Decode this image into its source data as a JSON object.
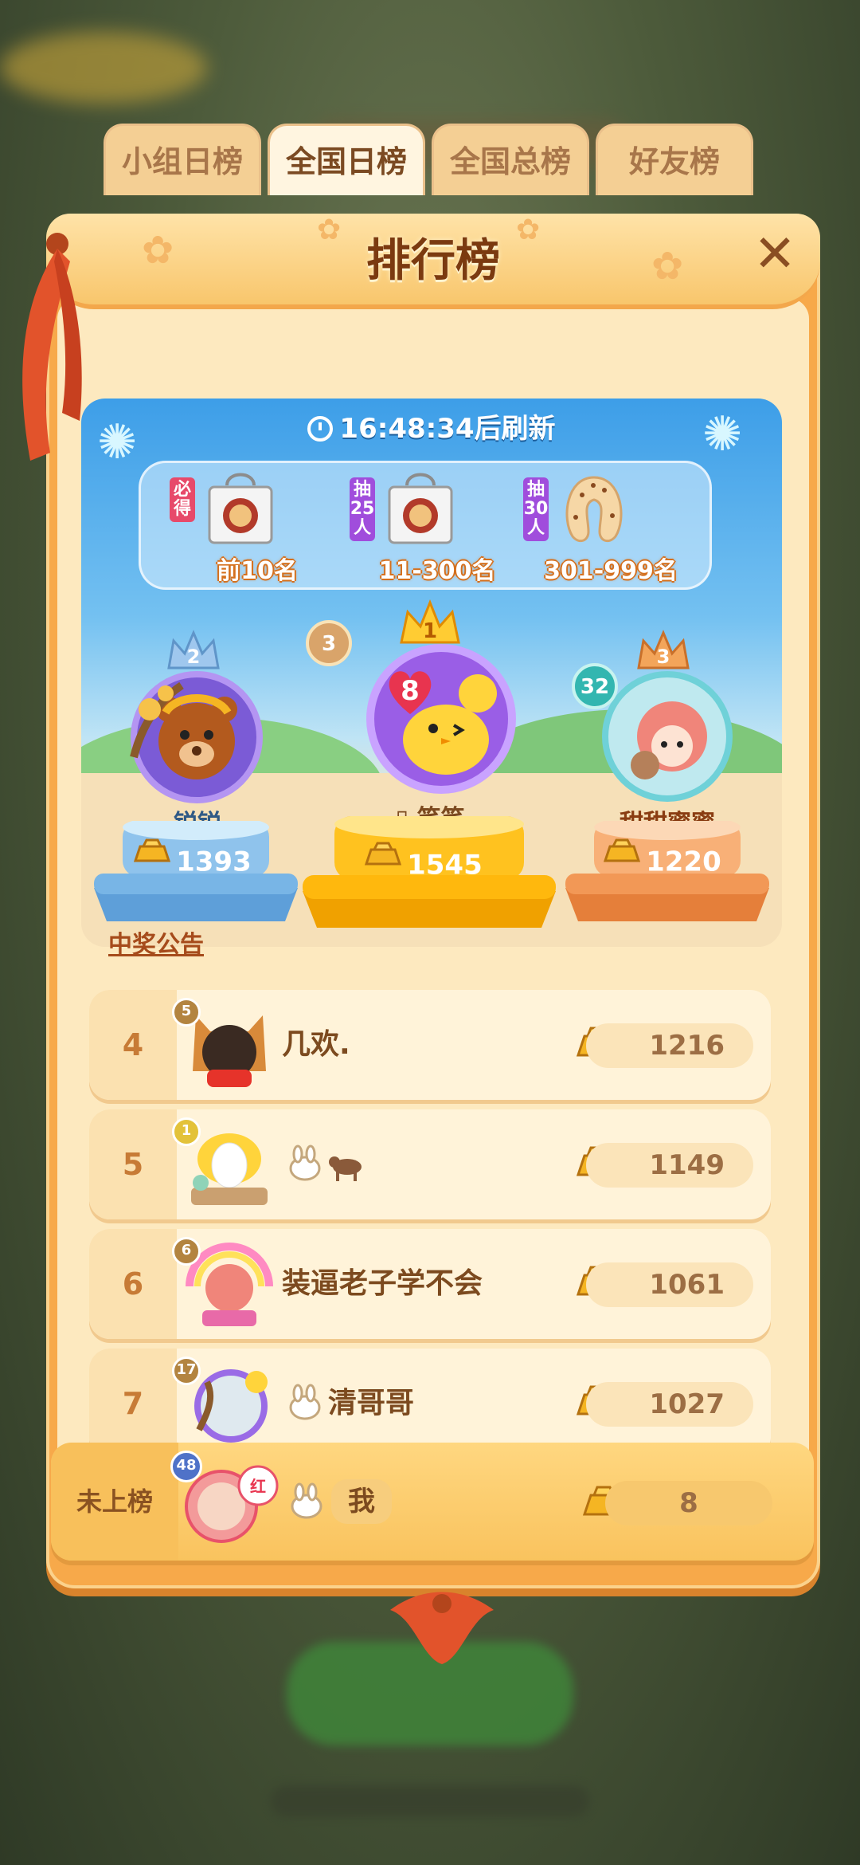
{
  "panel": {
    "title": "排行榜"
  },
  "tabs": [
    {
      "label": "小组日榜",
      "active": false
    },
    {
      "label": "全国日榜",
      "active": true
    },
    {
      "label": "全国总榜",
      "active": false
    },
    {
      "label": "好友榜",
      "active": false
    }
  ],
  "timer": {
    "time": "16:48:34",
    "suffix": "后刷新"
  },
  "prizes": [
    {
      "tag": "必得",
      "tag_color": "#e74a6a",
      "label": "前10名"
    },
    {
      "tag": "抽25人",
      "tag_color": "#a04ddc",
      "label": "11-300名"
    },
    {
      "tag": "抽30人",
      "tag_color": "#a04ddc",
      "label": "301-999名"
    }
  ],
  "podium": [
    {
      "rank": "1",
      "level": "3",
      "avatar_badge": "8",
      "name": "笑笑",
      "name_prefix": "▯",
      "score": "1545"
    },
    {
      "rank": "2",
      "name": "锐锐",
      "score": "1393"
    },
    {
      "rank": "3",
      "level": "32",
      "name": "甜甜蜜蜜",
      "score": "1220"
    }
  ],
  "notice": "中奖公告",
  "rows": [
    {
      "rank": "4",
      "level": "5",
      "name": "几欢.",
      "score": "1216"
    },
    {
      "rank": "5",
      "level": "1",
      "name": "",
      "score": "1149"
    },
    {
      "rank": "6",
      "level": "6",
      "name": "装逼老子学不会",
      "score": "1061"
    },
    {
      "rank": "7",
      "level": "17",
      "name": "清哥哥",
      "score": "1027"
    }
  ],
  "me": {
    "status": "未上榜",
    "level": "48",
    "name": "我",
    "score": "8"
  },
  "colors": {
    "panel_orange": "#f7a94a",
    "title_brown": "#7b3a10",
    "gold": "#f5b523"
  }
}
